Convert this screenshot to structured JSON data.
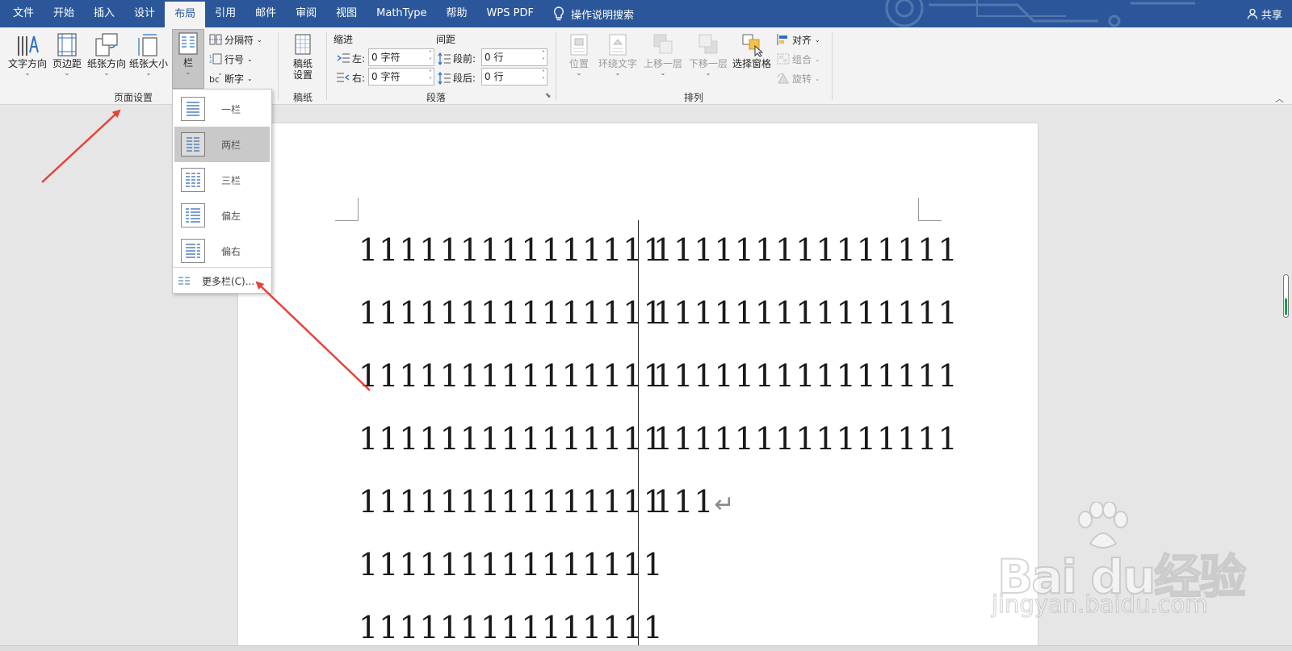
{
  "tabs": [
    {
      "label": "文件",
      "active": false
    },
    {
      "label": "开始",
      "active": false
    },
    {
      "label": "插入",
      "active": false
    },
    {
      "label": "设计",
      "active": false
    },
    {
      "label": "布局",
      "active": true
    },
    {
      "label": "引用",
      "active": false
    },
    {
      "label": "邮件",
      "active": false
    },
    {
      "label": "审阅",
      "active": false
    },
    {
      "label": "视图",
      "active": false
    },
    {
      "label": "MathType",
      "active": false
    },
    {
      "label": "帮助",
      "active": false
    },
    {
      "label": "WPS PDF",
      "active": false
    }
  ],
  "tell_me": {
    "label": "操作说明搜索",
    "icon": "lightbulb-icon"
  },
  "share": {
    "label": "共享",
    "icon": "person-icon"
  },
  "colors": {
    "accent": "#2b579a",
    "ribbon_bg": "#f3f3f3",
    "doc_bg": "#e6e6e6",
    "annotation_arrow": "#e8413a"
  },
  "ribbon": {
    "page_setup": {
      "label": "页面设置",
      "text_direction": "文字方向",
      "margins": "页边距",
      "orientation": "纸张方向",
      "size": "纸张大小",
      "columns": "栏",
      "breaks": "分隔符",
      "line_numbers": "行号",
      "hyphenation": "断字"
    },
    "manuscript": {
      "label": "稿纸",
      "setting_line1": "稿纸",
      "setting_line2": "设置"
    },
    "paragraph": {
      "label": "段落",
      "indent_header": "缩进",
      "spacing_header": "间距",
      "left_label": "左:",
      "left_value": "0 字符",
      "right_label": "右:",
      "right_value": "0 字符",
      "before_label": "段前:",
      "before_value": "0 行",
      "after_label": "段后:",
      "after_value": "0 行"
    },
    "arrange": {
      "label": "排列",
      "position": "位置",
      "wrap_text": "环绕文字",
      "bring_forward": "上移一层",
      "send_backward": "下移一层",
      "selection_pane": "选择窗格",
      "align": "对齐",
      "group": "组合",
      "rotate": "旋转"
    }
  },
  "columns_menu": {
    "items": [
      {
        "label": "一栏",
        "selected": false
      },
      {
        "label": "两栏",
        "selected": true
      },
      {
        "label": "三栏",
        "selected": false
      },
      {
        "label": "偏左",
        "selected": false
      },
      {
        "label": "偏右",
        "selected": false
      }
    ],
    "more": "更多栏(C)..."
  },
  "document": {
    "left_column": [
      "111111111111111",
      "111111111111111",
      "111111111111111",
      "111111111111111",
      "111111111111111",
      "111111111111111",
      "111111111111111"
    ],
    "right_column": [
      "111111111111111",
      "111111111111111",
      "111111111111111",
      "111111111111111",
      "111"
    ],
    "paragraph_mark": "↵"
  },
  "watermark": {
    "brand": "Bai du经验",
    "url": "jingyan.baidu.com"
  }
}
